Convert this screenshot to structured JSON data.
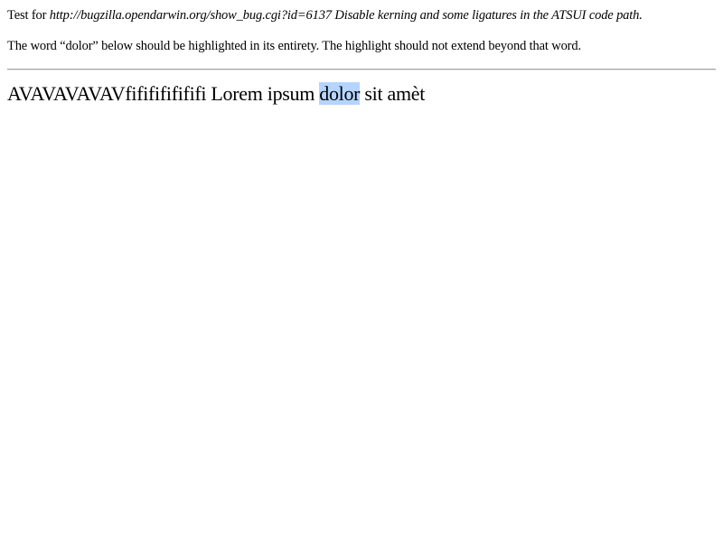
{
  "intro": {
    "prefix": "Test for ",
    "link_and_title": "http://bugzilla.opendarwin.org/show_bug.cgi?id=6137 Disable kerning and some ligatures in the ATSUI code path."
  },
  "description": "The word “dolor” below should be highlighted in its entirety. The highlight should not extend beyond that word.",
  "sample": {
    "before": "AVAVAVAVAVfififififififi Lorem ipsum ",
    "highlighted": "dolor",
    "after": " sit amèt"
  },
  "colors": {
    "highlight": "#b5d5ff",
    "rule": "#a0a0a0"
  }
}
